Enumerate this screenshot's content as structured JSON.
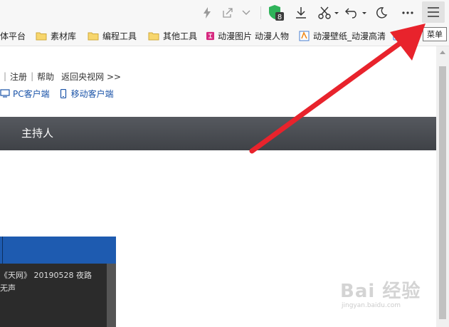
{
  "tooltip": {
    "menu": "菜单"
  },
  "toolbar": {
    "extension_badge": "8"
  },
  "bookmarks": [
    {
      "label": "体平台"
    },
    {
      "label": "素材库"
    },
    {
      "label": "编程工具"
    },
    {
      "label": "其他工具"
    },
    {
      "label": "动漫图片 动漫人物"
    },
    {
      "label": "动漫壁纸_动漫高清"
    }
  ],
  "page": {
    "links": [
      "注册",
      "帮助",
      "返回央视网 >>"
    ],
    "clients": [
      "PC客户端",
      "移动客户端"
    ],
    "nav_host": "主持人",
    "video_lines": [
      "《天网》 20190528 夜路",
      "无声"
    ]
  },
  "watermark": {
    "brand": "Bai 经验",
    "url": "jingyan.baidu.com"
  },
  "colors": {
    "nav_bg": "#4a4d53",
    "video_blue": "#1e5bb0",
    "arrow_red": "#e8232c",
    "link_blue": "#1a53a8"
  }
}
